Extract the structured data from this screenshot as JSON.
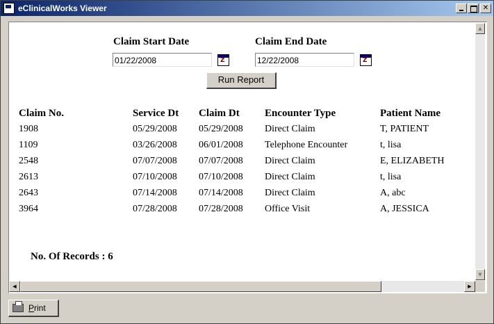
{
  "window": {
    "title": "eClinicalWorks Viewer",
    "controls": {
      "minimize": "_",
      "maximize": "□",
      "close": "✕"
    }
  },
  "filters": {
    "start_label": "Claim Start Date",
    "start_value": "01/22/2008",
    "end_label": "Claim End Date",
    "end_value": "12/22/2008",
    "calendar_icon": "calendar-icon"
  },
  "run_button": "Run Report",
  "table": {
    "headers": [
      "Claim No.",
      "Service Dt",
      "Claim Dt",
      "Encounter Type",
      "Patient Name"
    ],
    "rows": [
      [
        "1908",
        "05/29/2008",
        "05/29/2008",
        "Direct Claim",
        "T, PATIENT"
      ],
      [
        "1109",
        "03/26/2008",
        "06/01/2008",
        "Telephone Encounter",
        "t, lisa"
      ],
      [
        "2548",
        "07/07/2008",
        "07/07/2008",
        "Direct Claim",
        "E, ELIZABETH"
      ],
      [
        "2613",
        "07/10/2008",
        "07/10/2008",
        "Direct Claim",
        "t, lisa"
      ],
      [
        "2643",
        "07/14/2008",
        "07/14/2008",
        "Direct Claim",
        "A, abc"
      ],
      [
        "3964",
        "07/28/2008",
        "07/28/2008",
        "Office Visit",
        "A, JESSICA"
      ]
    ]
  },
  "records_label": "No. Of Records : 6",
  "scroll": {
    "up": "▲",
    "down": "▼",
    "left": "◀",
    "right": "▶"
  },
  "print_button": "Print"
}
